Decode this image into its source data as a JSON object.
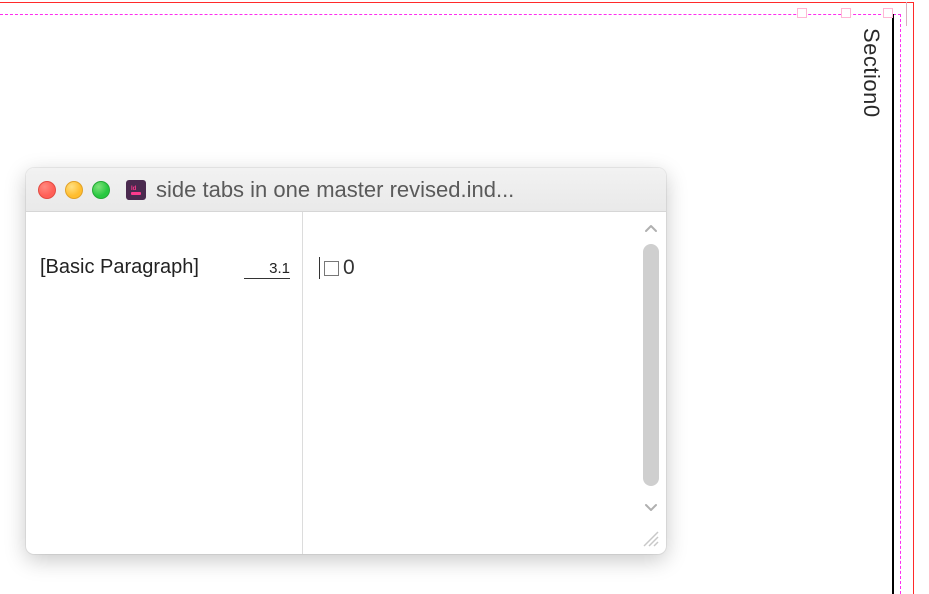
{
  "canvas": {
    "side_tab_label": "Section0"
  },
  "window": {
    "title": "side tabs in one master revised.ind...",
    "doc_icon_label": "indesign-document-icon",
    "editor": {
      "paragraph_style_name": "[Basic Paragraph]",
      "paragraph_style_number": "3.1",
      "content_value": "0"
    }
  }
}
